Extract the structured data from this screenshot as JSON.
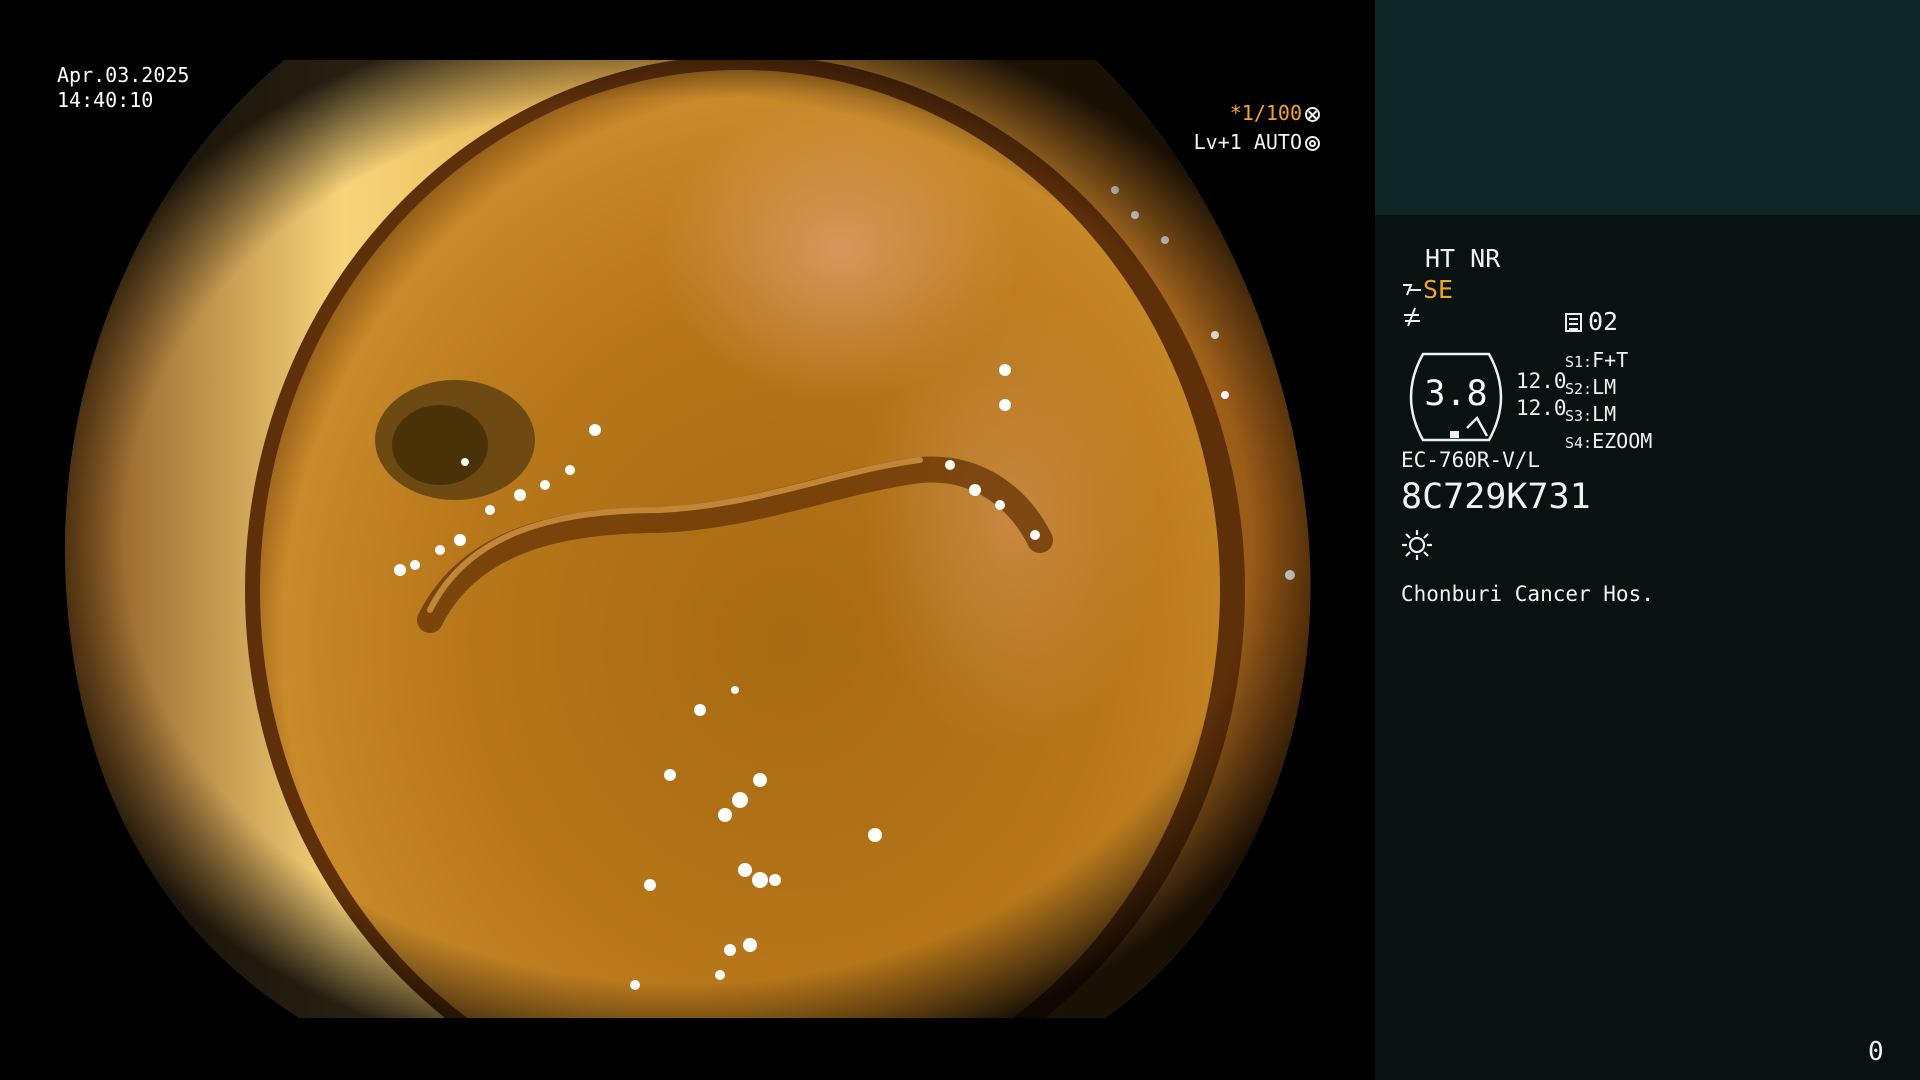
{
  "overlay": {
    "date": "Apr.03.2025",
    "time": "14:40:10",
    "shutter_prefix": "*",
    "shutter": "1/100",
    "exposure": "Lv+1 AUTO"
  },
  "panel": {
    "mode": "HT NR",
    "enhancement": "SE",
    "memo_label": "02",
    "gauge_value": "3.8",
    "gauge_side": [
      "12.0",
      "12.0"
    ],
    "switches": [
      {
        "key": "S1:",
        "value": "F+T"
      },
      {
        "key": "S2:",
        "value": "LM"
      },
      {
        "key": "S3:",
        "value": "LM"
      },
      {
        "key": "S4:",
        "value": "EZOOM"
      }
    ],
    "model": "EC-760R-V/L",
    "serial": "8C729K731",
    "hospital": "Chonburi Cancer Hos.",
    "counter": "0"
  },
  "colors": {
    "accent": "#f5a623",
    "panel_top": "#0f2526",
    "panel_bottom": "#071211"
  },
  "icons": [
    "aperture-icon",
    "iris-icon",
    "enhancement-icon",
    "structure-icon",
    "memo-icon",
    "sun-icon"
  ]
}
